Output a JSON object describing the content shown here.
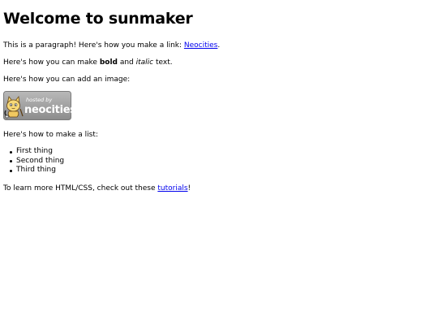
{
  "heading": "Welcome to sunmaker",
  "paragraph_link": {
    "before": "This is a paragraph! Here's how you make a link: ",
    "link_text": "Neocities",
    "after": "."
  },
  "paragraph_bold": {
    "before": "Here's how you can make ",
    "bold": "bold",
    "middle": " and ",
    "italic": "italic",
    "after": " text."
  },
  "paragraph_image": "Here's how you can add an image:",
  "image": {
    "alt": "hosted by neocities",
    "line1": "hosted by",
    "line2": "neocities"
  },
  "paragraph_list": "Here's how to make a list:",
  "list_items": [
    "First thing",
    "Second thing",
    "Third thing"
  ],
  "paragraph_learn": {
    "before": "To learn more HTML/CSS, check out these ",
    "link_text": "tutorials",
    "after": "!"
  }
}
